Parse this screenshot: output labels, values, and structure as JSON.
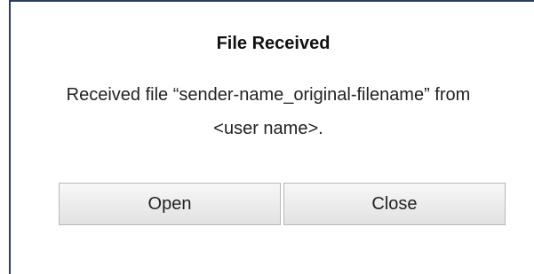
{
  "dialog": {
    "title": "File Received",
    "message": "Received file “sender-name_original-filename” from <user name>.",
    "buttons": {
      "open_label": "Open",
      "close_label": "Close"
    }
  }
}
